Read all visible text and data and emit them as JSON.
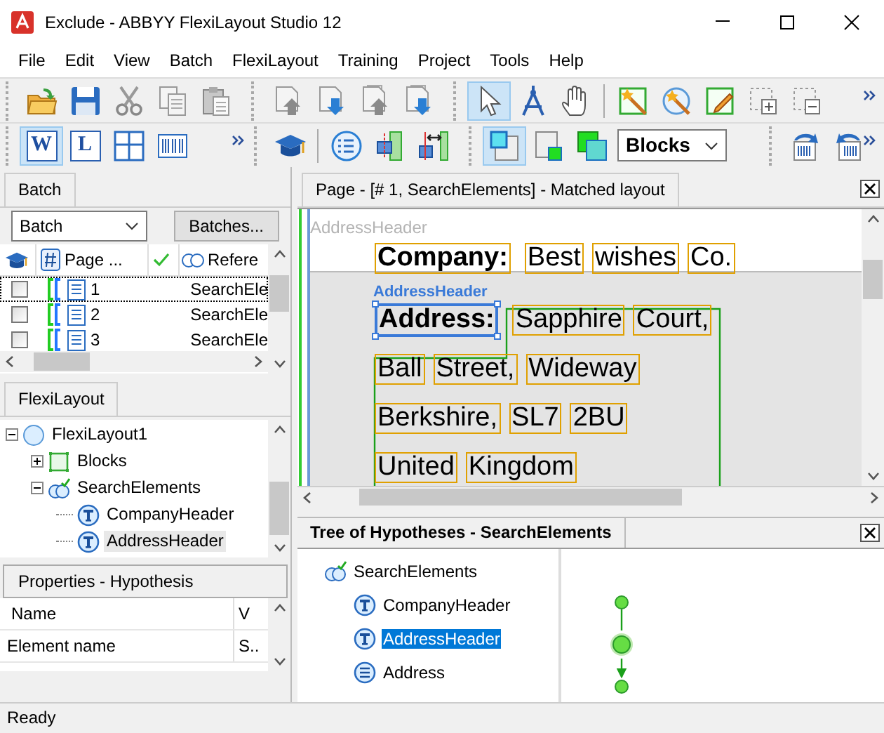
{
  "window": {
    "title": "Exclude - ABBYY FlexiLayout Studio 12"
  },
  "menu": [
    "File",
    "Edit",
    "View",
    "Batch",
    "FlexiLayout",
    "Training",
    "Project",
    "Tools",
    "Help"
  ],
  "toolbars": [
    {
      "groups": [
        {
          "buttons": [
            {
              "selected": false
            },
            {
              "selected": false
            },
            {
              "selected": false
            },
            {
              "selected": false
            },
            {
              "selected": false
            }
          ]
        },
        {
          "buttons": [
            {
              "selected": false
            },
            {
              "selected": false
            },
            {
              "selected": false
            },
            {
              "selected": false
            }
          ]
        },
        {
          "buttons": [
            {
              "selected": true
            },
            {
              "selected": false
            },
            {
              "selected": false
            },
            {
              "selected": false
            },
            {
              "selected": false
            },
            {
              "selected": false
            },
            {
              "selected": false
            },
            {
              "selected": false
            }
          ]
        }
      ]
    },
    {
      "groups": [
        {
          "buttons": [
            {
              "label": "W",
              "selected": true
            },
            {
              "label": "L",
              "selected": false
            },
            {
              "selected": false
            },
            {
              "selected": false
            }
          ]
        },
        {
          "buttons": [
            {
              "selected": false
            },
            {
              "selected": false
            },
            {
              "selected": false
            },
            {
              "selected": false
            }
          ]
        },
        {
          "buttons": [
            {
              "selected": true
            },
            {
              "selected": false
            },
            {
              "selected": false
            }
          ],
          "dropdown": {
            "value": "Blocks"
          }
        },
        {
          "buttons": [
            {
              "selected": false
            },
            {
              "selected": false
            }
          ]
        }
      ]
    }
  ],
  "batch_panel": {
    "tab": "Batch",
    "batch_select": {
      "value": "Batch"
    },
    "batches_button": "Batches...",
    "columns": [
      "Page ...",
      "Refere"
    ],
    "rows": [
      {
        "checked": false,
        "selected": true,
        "page": "1",
        "reference": "SearchEle"
      },
      {
        "checked": false,
        "selected": false,
        "page": "2",
        "reference": "SearchEle"
      },
      {
        "checked": false,
        "selected": false,
        "page": "3",
        "reference": "SearchEle"
      }
    ]
  },
  "flexilayout_panel": {
    "tab": "FlexiLayout",
    "tree": [
      {
        "label": "FlexiLayout1",
        "kind": "layout",
        "expanded": true,
        "selected": false,
        "children": [
          {
            "label": "Blocks",
            "kind": "blocks",
            "expanded": false,
            "selected": false
          },
          {
            "label": "SearchElements",
            "kind": "search",
            "expanded": true,
            "selected": false,
            "children": [
              {
                "label": "CompanyHeader",
                "kind": "header",
                "selected": false
              },
              {
                "label": "AddressHeader",
                "kind": "header",
                "selected": true
              }
            ]
          }
        ]
      }
    ]
  },
  "properties_panel": {
    "title": "Properties - Hypothesis",
    "columns": [
      "Name",
      "V"
    ],
    "rows": [
      {
        "name": "Element name",
        "value": "S.."
      }
    ]
  },
  "page_view": {
    "title": "Page - [# 1, SearchElements] - Matched layout",
    "faded_label": "AddressHeader",
    "element_label": "AddressHeader",
    "header_line": [
      {
        "text": "Company:",
        "bold": true,
        "selected": false
      },
      {
        "text": "Best",
        "bold": false,
        "selected": false
      },
      {
        "text": "wishes",
        "bold": false,
        "selected": false
      },
      {
        "text": "Co.",
        "bold": false,
        "selected": false
      }
    ],
    "lines": [
      [
        {
          "text": "Address:",
          "bold": true,
          "selected": true
        },
        {
          "text": "Sapphire",
          "bold": false,
          "selected": false
        },
        {
          "text": "Court,",
          "bold": false,
          "selected": false
        }
      ],
      [
        {
          "text": "Ball",
          "bold": false,
          "selected": false
        },
        {
          "text": "Street,",
          "bold": false,
          "selected": false
        },
        {
          "text": "Wideway",
          "bold": false,
          "selected": false
        }
      ],
      [
        {
          "text": "Berkshire,",
          "bold": false,
          "selected": false
        },
        {
          "text": "SL7",
          "bold": false,
          "selected": false
        },
        {
          "text": "2BU",
          "bold": false,
          "selected": false
        }
      ],
      [
        {
          "text": "United",
          "bold": false,
          "selected": false
        },
        {
          "text": "Kingdom",
          "bold": false,
          "selected": false
        }
      ]
    ]
  },
  "hypotheses_panel": {
    "title": "Tree of Hypotheses - SearchElements",
    "tree": [
      {
        "label": "SearchElements",
        "kind": "search",
        "selected": false,
        "children": [
          {
            "label": "CompanyHeader",
            "kind": "header",
            "selected": false
          },
          {
            "label": "AddressHeader",
            "kind": "header",
            "selected": true
          },
          {
            "label": "Address",
            "kind": "address",
            "selected": false
          }
        ]
      }
    ]
  },
  "status_bar": "Ready"
}
